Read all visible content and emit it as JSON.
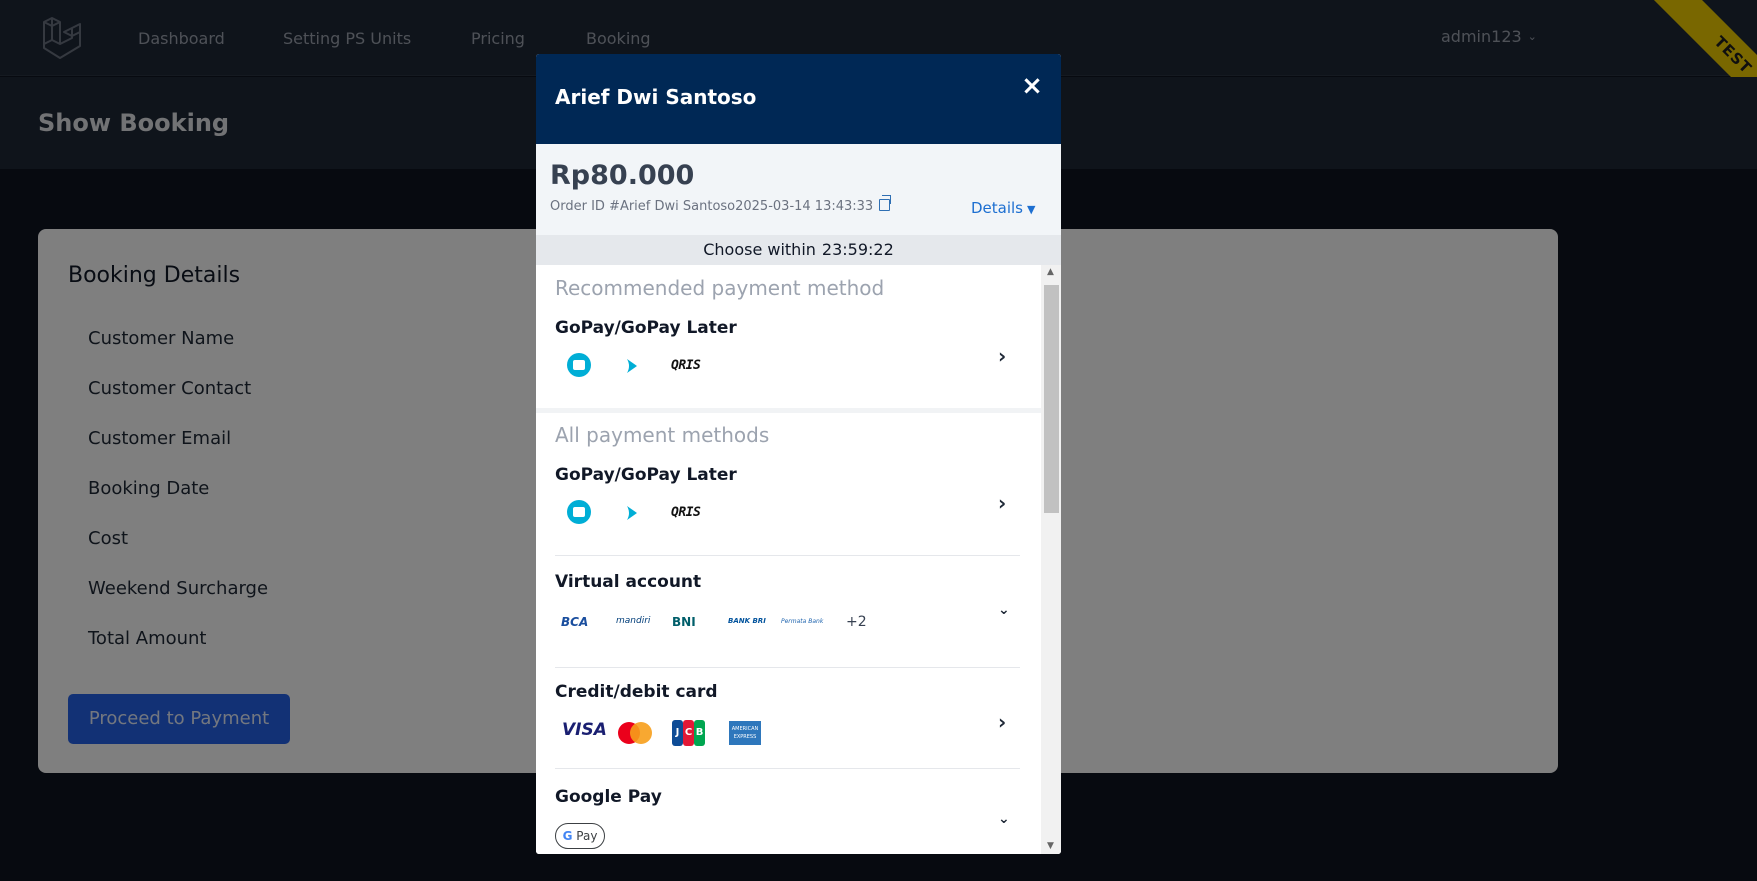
{
  "app": {
    "nav": [
      "Dashboard",
      "Setting PS Units",
      "Pricing",
      "Booking"
    ],
    "user": "admin123",
    "env_ribbon": "TEST",
    "page_title": "Show Booking"
  },
  "card": {
    "title": "Booking Details",
    "fields": [
      "Customer Name",
      "Customer Contact",
      "Customer Email",
      "Booking Date",
      "Cost",
      "Weekend Surcharge",
      "Total Amount"
    ],
    "proceed_button": "Proceed to Payment"
  },
  "modal": {
    "merchant_name": "Arief Dwi Santoso",
    "close_glyph": "×",
    "amount": "Rp80.000",
    "order_id": "Order ID #Arief Dwi Santoso2025-03-14 13:43:33",
    "details_label": "Details",
    "timer_label": "Choose within",
    "timer_value": "23:59:22",
    "recommended_title": "Recommended payment method",
    "all_title": "All payment methods",
    "methods": {
      "recommended_gopay": "GoPay/GoPay Later",
      "gopay": "GoPay/GoPay Later",
      "virtual_account": "Virtual account",
      "card": "Credit/debit card",
      "google_pay": "Google Pay"
    },
    "gopay_icons": [
      "gopay-wallet-icon",
      "gopay-later-icon",
      "qris-icon"
    ],
    "qris_text": "QRIS",
    "banks": [
      "BCA",
      "mandiri",
      "BNI",
      "BANK BRI",
      "Permata Bank"
    ],
    "banks_more": "+2",
    "card_brands": {
      "visa": "VISA",
      "jcb": [
        "J",
        "C",
        "B"
      ],
      "amex": "AMERICAN EXPRESS"
    },
    "gpay_badge": {
      "g": "G",
      "pay": "Pay"
    }
  },
  "colors": {
    "modal_header": "#002855",
    "accent_blue": "#1d6fd1",
    "proceed_button": "#2563eb",
    "gopay": "#00aed6",
    "test_ribbon": "#f2cf00"
  }
}
